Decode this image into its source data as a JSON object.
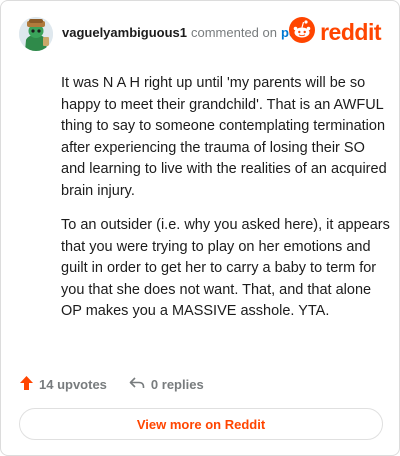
{
  "header": {
    "username": "vaguelyambiguous1",
    "commented_text": "commented on",
    "post_link": "post",
    "brand": "reddit"
  },
  "comment": {
    "paragraphs": [
      "It was N A H right up until 'my parents will be so happy to meet their grandchild'. That is an AWFUL thing to say to someone contemplating termination after experiencing the trauma of losing their SO and learning to live with the realities of an acquired brain injury.",
      "To an outsider (i.e. why you asked here), it appears that you were trying to play on her emotions and guilt in order to get her to carry a baby to term for you that she does not want. That, and that alone OP makes you a MASSIVE asshole. YTA."
    ]
  },
  "actions": {
    "upvotes": "14 upvotes",
    "replies": "0 replies"
  },
  "footer": {
    "view_more": "View more on Reddit"
  },
  "icons": {
    "upvote": "upvote-arrow-icon",
    "reply": "reply-arrow-icon",
    "brand": "reddit-snoo-icon"
  },
  "colors": {
    "brand": "#ff4500",
    "link": "#0079d3",
    "muted": "#787c7e"
  }
}
